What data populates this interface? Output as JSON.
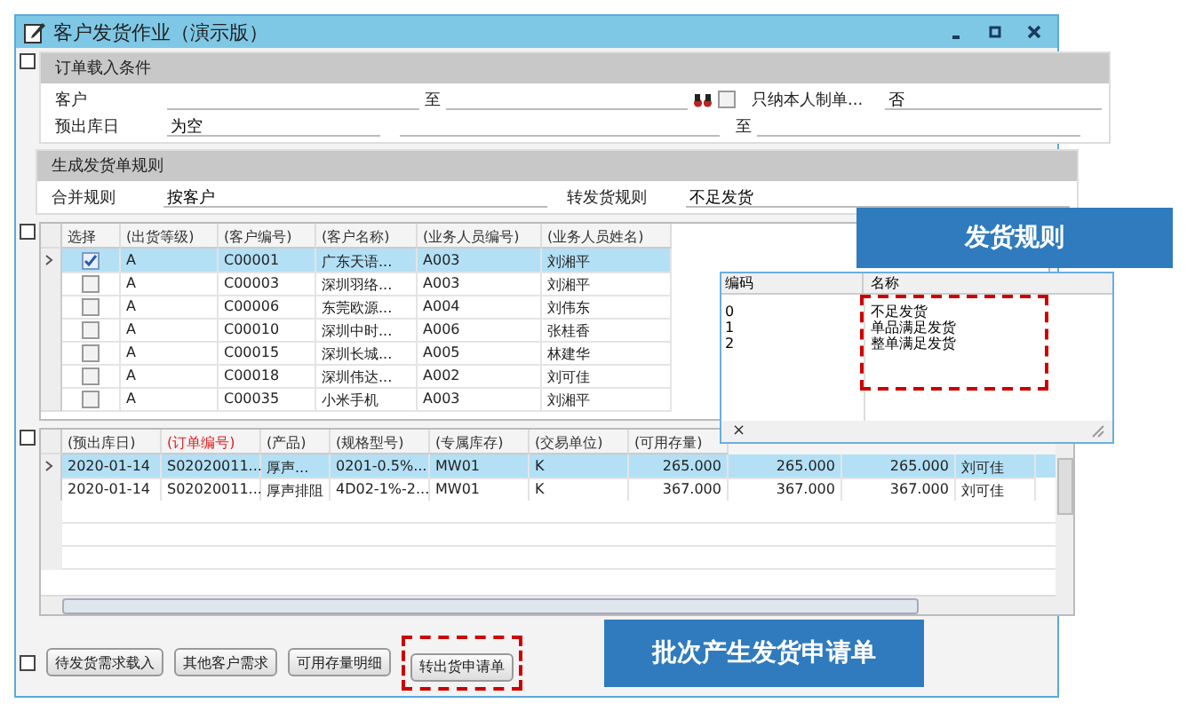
{
  "window": {
    "title": "客户发货作业（演示版）"
  },
  "order_conditions": {
    "title": "订单载入条件",
    "customer_label": "客户",
    "customer_to": "至",
    "own_only": {
      "label": "只纳本人制单...",
      "checked": false,
      "value": "否"
    },
    "date_label": "预出库日",
    "date_from": "为空",
    "date_to": "至"
  },
  "rules": {
    "title": "生成发货单规则",
    "merge_label": "合并规则",
    "merge_value": "按客户",
    "transfer_label": "转发货规则",
    "transfer_value": "不足发货"
  },
  "customers": {
    "columns": [
      "选择",
      "(出货等级)",
      "(客户编号)",
      "(客户名称)",
      "(业务人员编号)",
      "(业务人员姓名)"
    ],
    "rows": [
      {
        "selected": true,
        "checked": true,
        "cells": [
          "",
          "A",
          "C00001",
          "广东天语...",
          "A003",
          "刘湘平"
        ]
      },
      {
        "selected": false,
        "checked": false,
        "cells": [
          "",
          "A",
          "C00003",
          "深圳羽络...",
          "A003",
          "刘湘平"
        ]
      },
      {
        "selected": false,
        "checked": false,
        "cells": [
          "",
          "A",
          "C00006",
          "东莞欧源...",
          "A004",
          "刘伟东"
        ]
      },
      {
        "selected": false,
        "checked": false,
        "cells": [
          "",
          "A",
          "C00010",
          "深圳中时...",
          "A006",
          "张桂香"
        ]
      },
      {
        "selected": false,
        "checked": false,
        "cells": [
          "",
          "A",
          "C00015",
          "深圳长城...",
          "A005",
          "林建华"
        ]
      },
      {
        "selected": false,
        "checked": false,
        "cells": [
          "",
          "A",
          "C00018",
          "深圳伟达...",
          "A002",
          "刘可佳"
        ]
      },
      {
        "selected": false,
        "checked": false,
        "cells": [
          "",
          "A",
          "C00035",
          "小米手机",
          "A003",
          "刘湘平"
        ]
      }
    ]
  },
  "orders": {
    "columns": [
      {
        "label": "(预出库日)",
        "highlighted": false
      },
      {
        "label": "(订单编号)",
        "highlighted": true
      },
      {
        "label": "(产品)",
        "highlighted": false
      },
      {
        "label": "(规格型号)",
        "highlighted": false
      },
      {
        "label": "(专属库存)",
        "highlighted": false
      },
      {
        "label": "(交易单位)",
        "highlighted": false
      },
      {
        "label": "(可用存量)",
        "highlighted": false
      }
    ],
    "rows": [
      {
        "selected": true,
        "cells": [
          "2020-01-14",
          "S02020011...",
          "厚声...",
          "0201-0.5%...",
          "MW01",
          "K",
          "265.000",
          "265.000",
          "265.000",
          "刘可佳"
        ]
      },
      {
        "selected": false,
        "cells": [
          "2020-01-14",
          "S02020011...",
          "厚声排阻",
          "4D02-1%-2...",
          "MW01",
          "K",
          "367.000",
          "367.000",
          "367.000",
          "刘可佳"
        ]
      }
    ]
  },
  "rule_popup": {
    "columns": [
      "编码",
      "名称"
    ],
    "rows": [
      [
        "0",
        "不足发货"
      ],
      [
        "1",
        "单品满足发货"
      ],
      [
        "2",
        "整单满足发货"
      ]
    ],
    "close": "×"
  },
  "buttons": [
    {
      "label": "待发货需求载入",
      "marked": false
    },
    {
      "label": "其他客户需求",
      "marked": false
    },
    {
      "label": "可用存量明细",
      "marked": false
    },
    {
      "label": "转出货申请单",
      "marked": true
    }
  ],
  "callouts": [
    "发货规则",
    "批次产生发货申请单"
  ]
}
